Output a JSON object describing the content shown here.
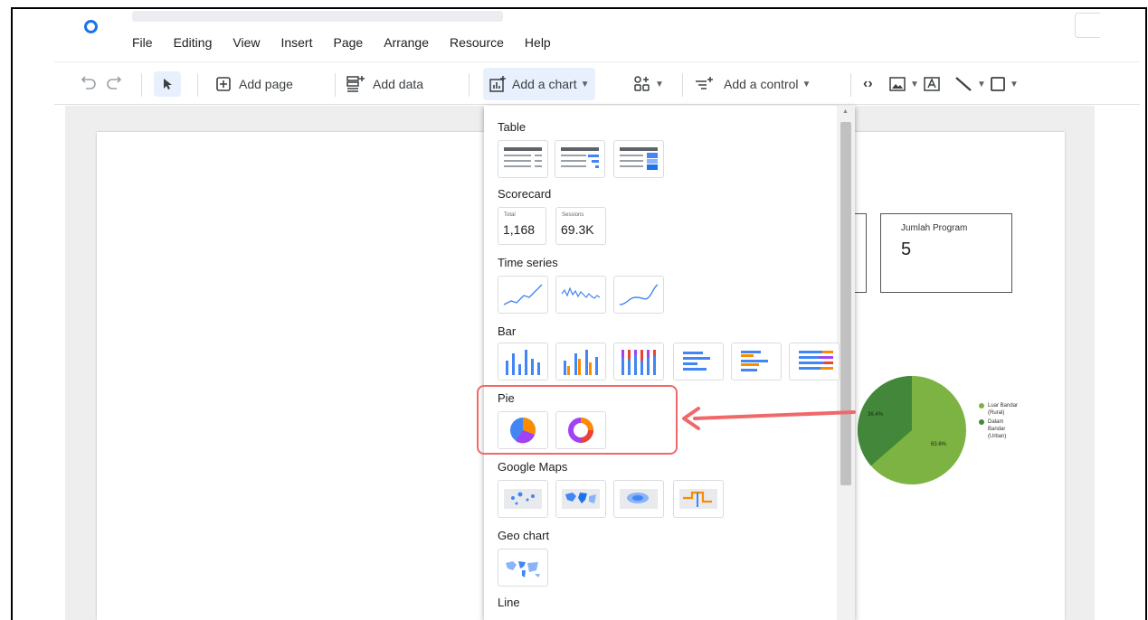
{
  "menu": [
    "File",
    "Editing",
    "View",
    "Insert",
    "Page",
    "Arrange",
    "Resource",
    "Help"
  ],
  "toolbar": {
    "add_page": "Add page",
    "add_data": "Add data",
    "add_chart": "Add a chart",
    "add_control": "Add a control"
  },
  "card": {
    "label": "Jumlah Program",
    "value": "5"
  },
  "pie": {
    "label_small": "36.4%",
    "label_large": "63.6%",
    "legend": [
      "Luar Bandar (Rural)",
      "Dalam Bandar (Urban)"
    ],
    "colors": [
      "#7cb342",
      "#43883a"
    ]
  },
  "chart_menu": {
    "sections": {
      "table": "Table",
      "scorecard": "Scorecard",
      "time_series": "Time series",
      "bar": "Bar",
      "pie": "Pie",
      "maps": "Google Maps",
      "geo": "Geo chart",
      "line": "Line"
    },
    "scorecards": [
      {
        "title": "Total",
        "value": "1,168"
      },
      {
        "title": "Sessions",
        "value": "69.3K"
      }
    ]
  },
  "colors": {
    "accent": "#1a73e8",
    "highlight": "#f0696a"
  }
}
